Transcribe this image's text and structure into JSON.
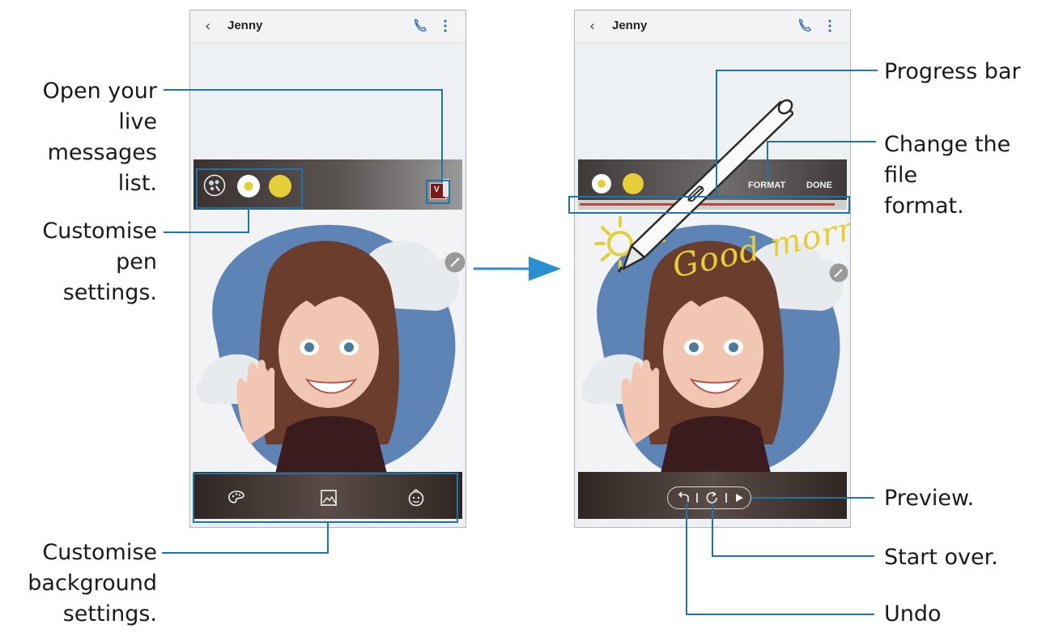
{
  "left_phone": {
    "contact": "Jenny",
    "pen_colors": [
      "#ffffff",
      "#e6cd3a"
    ],
    "pen_inner_color": "#e6cd3a",
    "live_list_badge": "V",
    "bottom_icons": [
      "palette-icon",
      "image-icon",
      "emoji-icon"
    ]
  },
  "right_phone": {
    "contact": "Jenny",
    "format_label": "FORMAT",
    "done_label": "DONE",
    "progress": 0.96,
    "drawing_text": "Good morning!",
    "controls": [
      "undo-icon",
      "restart-icon",
      "play-icon"
    ]
  },
  "callouts": {
    "open_list": "Open your live messages list.",
    "open_list_l1": "Open your live",
    "open_list_l2": "messages list.",
    "pen_l1": "Customise pen",
    "pen_l2": "settings.",
    "bg_l1": "Customise",
    "bg_l2": "background",
    "bg_l3": "settings.",
    "progress_bar": "Progress bar",
    "file_l1": "Change the file",
    "file_l2": "format.",
    "preview": "Preview.",
    "start_over": "Start over.",
    "undo": "Undo"
  },
  "colors": {
    "leader": "#1f74a8",
    "arrow": "#2a8fd0",
    "pen_yellow": "#e6cd3a",
    "bg_blue": "#5e84b5"
  }
}
